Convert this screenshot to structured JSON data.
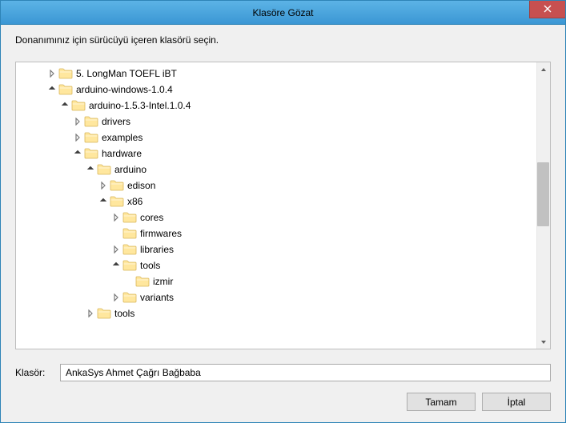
{
  "window": {
    "title": "Klasöre Gözat"
  },
  "instruction": "Donanımınız için sürücüyü içeren klasörü seçin.",
  "tree": [
    {
      "depth": 0,
      "expander": "closed",
      "label": "5. LongMan TOEFL iBT"
    },
    {
      "depth": 0,
      "expander": "open",
      "label": "arduino-windows-1.0.4"
    },
    {
      "depth": 1,
      "expander": "open",
      "label": "arduino-1.5.3-Intel.1.0.4"
    },
    {
      "depth": 2,
      "expander": "closed",
      "label": "drivers"
    },
    {
      "depth": 2,
      "expander": "closed",
      "label": "examples"
    },
    {
      "depth": 2,
      "expander": "open",
      "label": "hardware"
    },
    {
      "depth": 3,
      "expander": "open",
      "label": "arduino"
    },
    {
      "depth": 4,
      "expander": "closed",
      "label": "edison"
    },
    {
      "depth": 4,
      "expander": "open",
      "label": "x86"
    },
    {
      "depth": 5,
      "expander": "closed",
      "label": "cores"
    },
    {
      "depth": 5,
      "expander": "none",
      "label": "firmwares"
    },
    {
      "depth": 5,
      "expander": "closed",
      "label": "libraries"
    },
    {
      "depth": 5,
      "expander": "open",
      "label": "tools"
    },
    {
      "depth": 6,
      "expander": "none",
      "label": "izmir"
    },
    {
      "depth": 5,
      "expander": "closed",
      "label": "variants"
    },
    {
      "depth": 3,
      "expander": "closed",
      "label": "tools"
    }
  ],
  "field": {
    "label": "Klasör:",
    "value": "AnkaSys Ahmet Çağrı Bağbaba"
  },
  "buttons": {
    "ok": "Tamam",
    "cancel": "İptal"
  }
}
